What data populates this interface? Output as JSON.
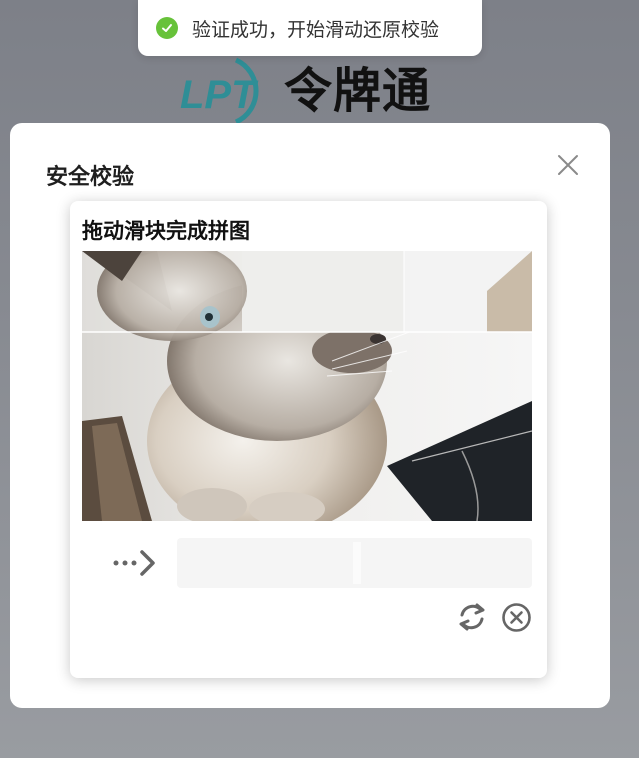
{
  "toast": {
    "icon": "check-circle-icon",
    "text": "验证成功，开始滑动还原校验",
    "color": "#67c23a"
  },
  "background": {
    "logo_mark_text": "LPT",
    "brand_name": "令牌通",
    "brand_color": "#2f8e96"
  },
  "modal": {
    "title": "安全校验",
    "close_icon": "close-icon"
  },
  "captcha": {
    "title": "拖动滑块完成拼图",
    "image_subject": "cat",
    "slider_icon": "arrow-right-icon",
    "refresh_icon": "refresh-icon",
    "cancel_icon": "close-circle-icon"
  }
}
